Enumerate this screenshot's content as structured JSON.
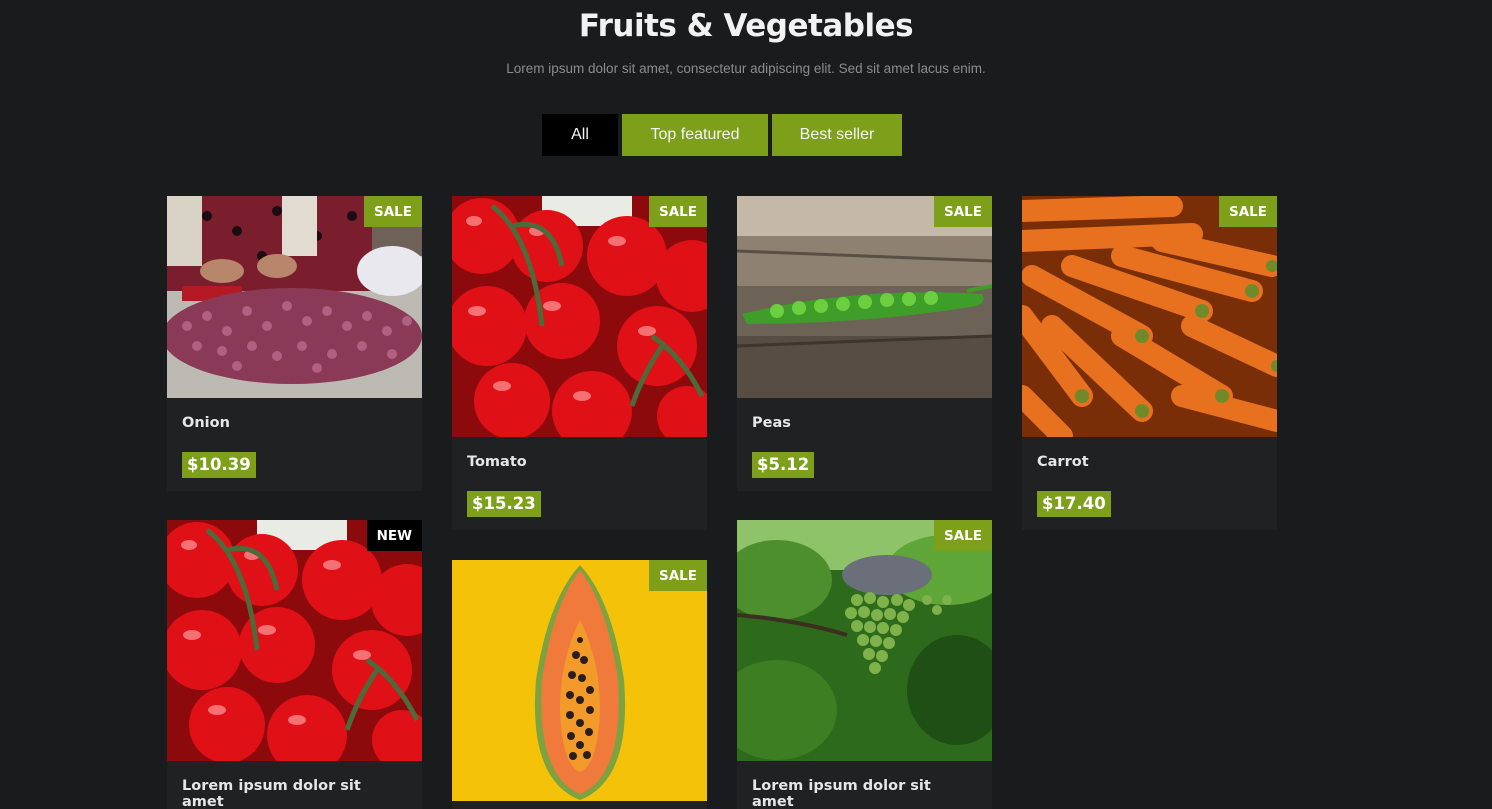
{
  "header": {
    "title": "Fruits & Vegetables",
    "subtitle": "Lorem ipsum dolor sit amet, consectetur adipiscing elit. Sed sit amet lacus enim."
  },
  "filters": [
    {
      "label": "All",
      "active": true
    },
    {
      "label": "Top featured",
      "active": false
    },
    {
      "label": "Best seller",
      "active": false
    }
  ],
  "colors": {
    "background": "#1a1b1d",
    "accent": "#7e9f19",
    "card": "#202123"
  },
  "products": [
    {
      "name": "Onion",
      "price": "$10.39",
      "badge": "SALE",
      "image": "onion-market-photo"
    },
    {
      "name": "Tomato",
      "price": "$15.23",
      "badge": "SALE",
      "image": "tomatoes-photo"
    },
    {
      "name": "Peas",
      "price": "$5.12",
      "badge": "SALE",
      "image": "pea-pod-photo"
    },
    {
      "name": "Carrot",
      "price": "$17.40",
      "badge": "SALE",
      "image": "carrots-photo"
    },
    {
      "name": "Lorem ipsum dolor sit amet",
      "price": "",
      "badge": "NEW",
      "image": "tomatoes-photo"
    },
    {
      "name": "",
      "price": "",
      "badge": "SALE",
      "image": "papaya-photo"
    },
    {
      "name": "Lorem ipsum dolor sit amet",
      "price": "",
      "badge": "SALE",
      "image": "grapes-photo"
    }
  ]
}
